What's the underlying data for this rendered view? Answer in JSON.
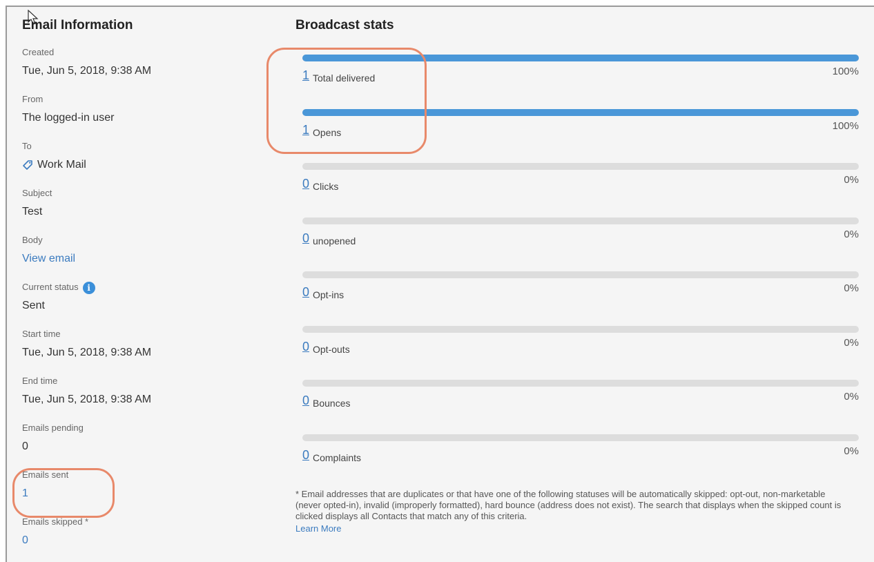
{
  "left": {
    "title": "Email Information",
    "fields": [
      {
        "label": "Created",
        "value": "Tue, Jun 5, 2018, 9:38 AM"
      },
      {
        "label": "From",
        "value": "The logged-in user"
      },
      {
        "label": "To",
        "value": "Work Mail",
        "icon": "tag-icon"
      },
      {
        "label": "Subject",
        "value": "Test"
      },
      {
        "label": "Body",
        "value": "View email"
      },
      {
        "label": "Current status",
        "value": "Sent",
        "icon": "info-icon"
      },
      {
        "label": "Start time",
        "value": "Tue, Jun 5, 2018, 9:38 AM"
      },
      {
        "label": "End time",
        "value": "Tue, Jun 5, 2018, 9:38 AM"
      },
      {
        "label": "Emails pending",
        "value": "0"
      },
      {
        "label": "Emails sent",
        "value": "1"
      },
      {
        "label": "Emails skipped *",
        "value": "0"
      }
    ]
  },
  "right": {
    "title": "Broadcast stats",
    "stats": [
      {
        "count": "1",
        "label": "Total delivered",
        "percent": "100%",
        "fill": 1.0
      },
      {
        "count": "1",
        "label": "Opens",
        "percent": "100%",
        "fill": 1.0
      },
      {
        "count": "0",
        "label": "Clicks",
        "percent": "0%",
        "fill": 0
      },
      {
        "count": "0",
        "label": "unopened",
        "percent": "0%",
        "fill": 0
      },
      {
        "count": "0",
        "label": "Opt-ins",
        "percent": "0%",
        "fill": 0
      },
      {
        "count": "0",
        "label": "Opt-outs",
        "percent": "0%",
        "fill": 0
      },
      {
        "count": "0",
        "label": "Bounces",
        "percent": "0%",
        "fill": 0
      },
      {
        "count": "0",
        "label": "Complaints",
        "percent": "0%",
        "fill": 0
      }
    ],
    "footnote": "* Email addresses that are duplicates or that have one of the following statuses will be automatically skipped: opt-out, non-marketable (never opted-in), invalid (improperly formatted), hard bounce (address does not exist). The search that displays when the skipped count is clicked displays all Contacts that match any of this criteria.",
    "learn_more": "Learn More"
  },
  "colors": {
    "accent": "#4a97d8",
    "link": "#3b7bbf",
    "annotation": "#e8896a",
    "track": "#dddddd"
  }
}
